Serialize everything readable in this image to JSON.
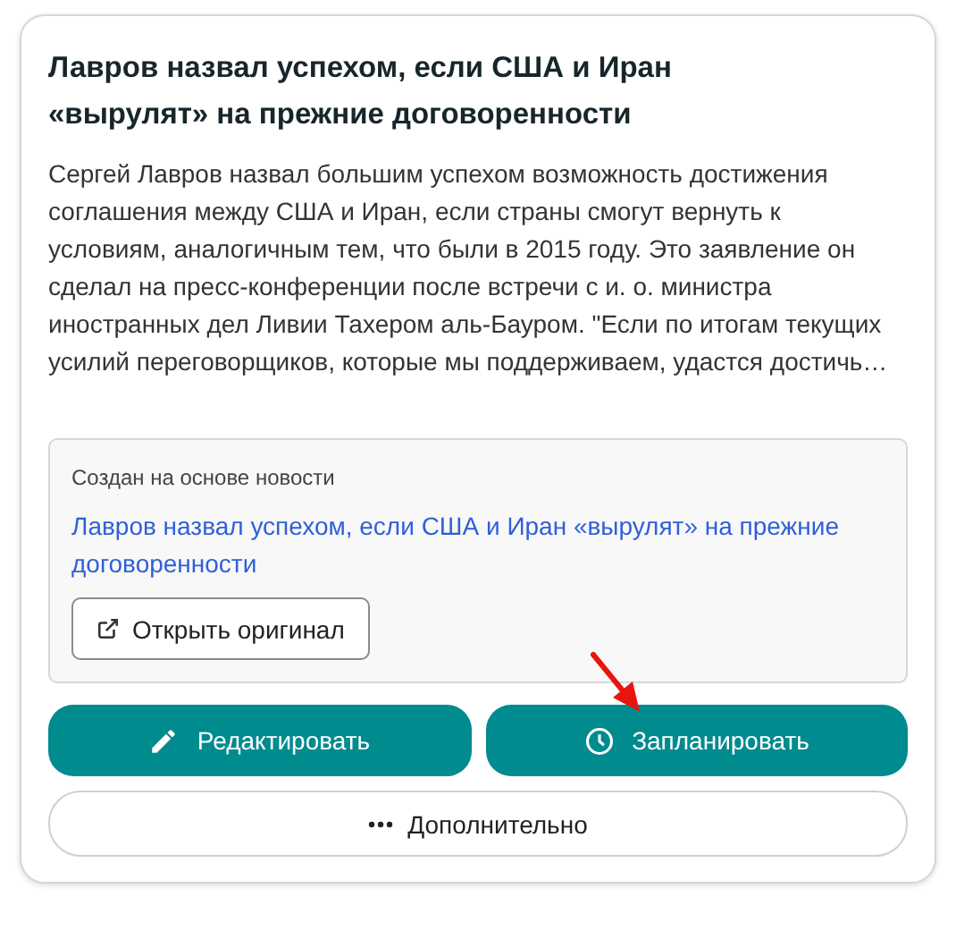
{
  "card": {
    "title": "Лавров назвал успехом, если США и Иран «вырулят» на прежние договоренности",
    "summary": "Сергей Лавров назвал большим успехом возможность достижения соглашения между США и Иран, если страны смогут вернуть к условиям, аналогичным тем, что были в 2015 году. Это заявление он сделал на пресс-конференции после встречи с и. о. министра иностранных дел Ливии Тахером аль-Бауром. \"Если по итогам текущих усилий переговорщиков, которые мы поддерживаем, удастся достичь…",
    "source": {
      "caption": "Создан на основе новости",
      "link": "Лавров назвал успехом, если США и Иран «вырулят» на прежние договоренности",
      "button": "Открыть оригинал"
    },
    "actions": [
      {
        "kind": "edit",
        "label": "Редактировать"
      },
      {
        "kind": "schedule",
        "label": "Запланировать"
      }
    ],
    "more": {
      "label": "Дополнительно"
    }
  }
}
